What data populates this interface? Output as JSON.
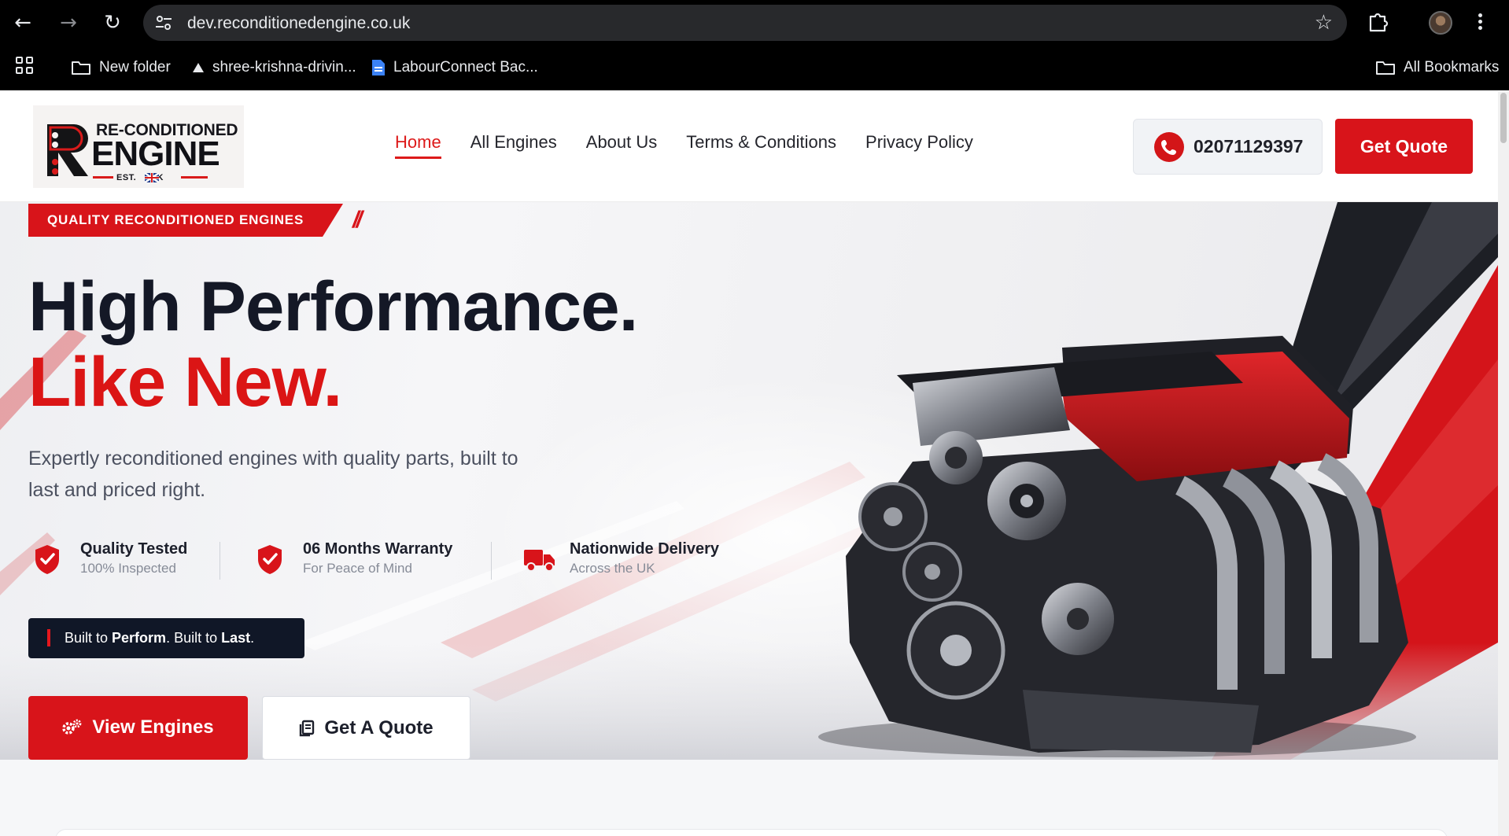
{
  "browser": {
    "url": "dev.reconditionedengine.co.uk",
    "bookmarks": [
      {
        "label": "New folder",
        "icon": "folder-icon"
      },
      {
        "label": "shree-krishna-drivin...",
        "icon": "drive-icon"
      },
      {
        "label": "LabourConnect Bac...",
        "icon": "docs-icon"
      }
    ],
    "all_bookmarks_label": "All Bookmarks"
  },
  "header": {
    "logo": {
      "line1": "RE-CONDITIONED",
      "line2": "ENGINE",
      "tagline": "EST.     UK"
    },
    "nav": [
      {
        "label": "Home",
        "active": true
      },
      {
        "label": "All Engines",
        "active": false
      },
      {
        "label": "About Us",
        "active": false
      },
      {
        "label": "Terms & Conditions",
        "active": false
      },
      {
        "label": "Privacy Policy",
        "active": false
      }
    ],
    "phone": "02071129397",
    "cta_label": "Get Quote"
  },
  "hero": {
    "badge": "QUALITY RECONDITIONED ENGINES",
    "badge_mark": "//",
    "headline_line1": "High Performance.",
    "headline_line2": "Like New.",
    "subtext": "Expertly reconditioned engines with quality parts, built to last and priced right.",
    "features": [
      {
        "title": "Quality Tested",
        "subtitle": "100% Inspected",
        "icon": "shield-check-icon"
      },
      {
        "title": "06 Months Warranty",
        "subtitle": "For Peace of Mind",
        "icon": "shield-check-icon"
      },
      {
        "title": "Nationwide Delivery",
        "subtitle": "Across the UK",
        "icon": "truck-icon"
      }
    ],
    "tagline": {
      "part1": "Built to ",
      "part2": "Perform",
      "part3": ". Built to ",
      "part4": "Last",
      "part5": "."
    },
    "btn_primary": "View Engines",
    "btn_secondary": "Get A Quote"
  },
  "colors": {
    "accent": "#d8141a",
    "dark": "#141826",
    "tagline_bg": "#101727"
  }
}
